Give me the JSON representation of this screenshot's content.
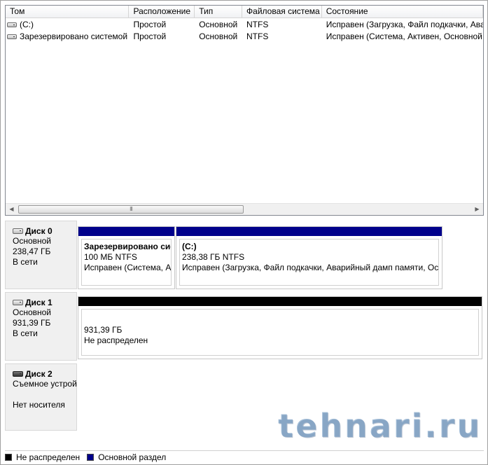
{
  "colors": {
    "primary_partition": "#00008b",
    "unallocated": "#000000",
    "accent_blue_watermark": "#5f8cb9"
  },
  "volume_list": {
    "columns": [
      "Том",
      "Расположение",
      "Тип",
      "Файловая система",
      "Состояние"
    ],
    "rows": [
      {
        "icon": "drive-icon",
        "name": "(C:)",
        "layout": "Простой",
        "type": "Основной",
        "fs": "NTFS",
        "status": "Исправен (Загрузка, Файл подкачки, Ава"
      },
      {
        "icon": "drive-icon",
        "name": "Зарезервировано системой",
        "layout": "Простой",
        "type": "Основной",
        "fs": "NTFS",
        "status": "Исправен (Система, Активен, Основной р"
      }
    ],
    "scroll_thumb_grip": "III"
  },
  "disks": [
    {
      "title": "Диск 0",
      "kind": "Основной",
      "size": "238,47 ГБ",
      "state": "В сети",
      "icon": "drive-icon",
      "partitions": [
        {
          "name": "Зарезервировано системой",
          "size_fs": "100 МБ NTFS",
          "status": "Исправен (Система, Активен, Основной раздел)",
          "bar": "primary"
        },
        {
          "name": "(C:)",
          "size_fs": "238,38 ГБ NTFS",
          "status": "Исправен (Загрузка, Файл подкачки, Аварийный дамп памяти, Основной раздел)",
          "bar": "primary"
        }
      ]
    },
    {
      "title": "Диск 1",
      "kind": "Основной",
      "size": "931,39 ГБ",
      "state": "В сети",
      "icon": "drive-icon",
      "partitions": [
        {
          "size": "931,39 ГБ",
          "status": "Не распределен",
          "bar": "unallocated"
        }
      ]
    },
    {
      "title": "Диск 2",
      "kind": "Съемное устройство",
      "state": "Нет носителя",
      "icon": "removable-drive-icon"
    }
  ],
  "legend": [
    {
      "label": "Не распределен",
      "color": "#000000"
    },
    {
      "label": "Основной раздел",
      "color": "#00008b"
    }
  ],
  "watermark": "tehnari.ru"
}
